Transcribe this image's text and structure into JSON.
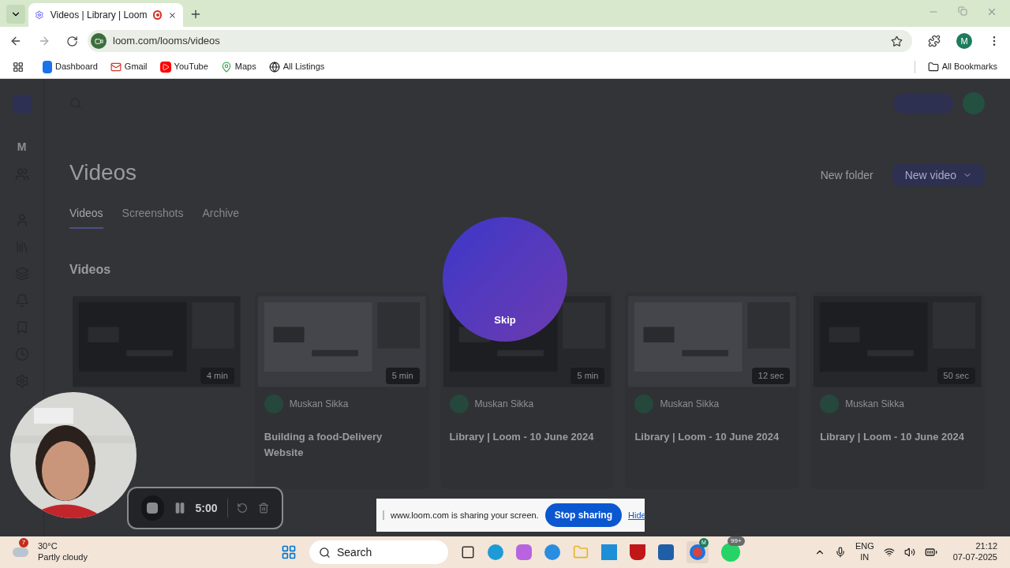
{
  "browser": {
    "tabs": [
      {
        "title": "Videos | Library | Loom",
        "selected": true,
        "recording": true
      }
    ],
    "url": "loom.com/looms/videos",
    "profile": "M",
    "bookmarks": [
      {
        "label": "Dashboard",
        "kind": "b"
      },
      {
        "label": "Gmail",
        "kind": "mail"
      },
      {
        "label": "YouTube",
        "kind": "play"
      },
      {
        "label": "Maps",
        "kind": "pin"
      },
      {
        "label": "All Listings",
        "kind": "globe"
      }
    ],
    "bookmarks_folder": "All Bookmarks"
  },
  "page": {
    "sidebar_avatar": "M",
    "title": "Videos",
    "tabs": [
      {
        "label": "Videos",
        "selected": true
      },
      {
        "label": "Screenshots",
        "selected": false
      },
      {
        "label": "Archive",
        "selected": false
      }
    ],
    "new_folder": "New folder",
    "new_video": "New video",
    "section": "Videos",
    "cards": [
      {
        "duration": "4 min"
      },
      {
        "duration": "5 min",
        "author": "Muskan Sikka",
        "title": "Building a food-Delivery Website"
      },
      {
        "duration": "5 min",
        "author": "Muskan Sikka",
        "title": "Library | Loom - 10 June 2024"
      },
      {
        "duration": "12 sec",
        "author": "Muskan Sikka",
        "title": "Library | Loom - 10 June 2024"
      },
      {
        "duration": "50 sec",
        "author": "Muskan Sikka",
        "title": "Library | Loom - 10 June 2024"
      }
    ]
  },
  "overlay": {
    "skip": "Skip",
    "timer": "5:00",
    "share_message": "www.loom.com is sharing your screen.",
    "stop_sharing": "Stop sharing",
    "hide": "Hide"
  },
  "taskbar": {
    "weather_badge": "7",
    "temperature": "30°C",
    "weather": "Partly cloudy",
    "search": "Search",
    "chrome_badge": "M",
    "whatsapp_badge": "99+",
    "lang": "ENG",
    "region": "IN",
    "time": "21:12",
    "date": "07-07-2025"
  }
}
